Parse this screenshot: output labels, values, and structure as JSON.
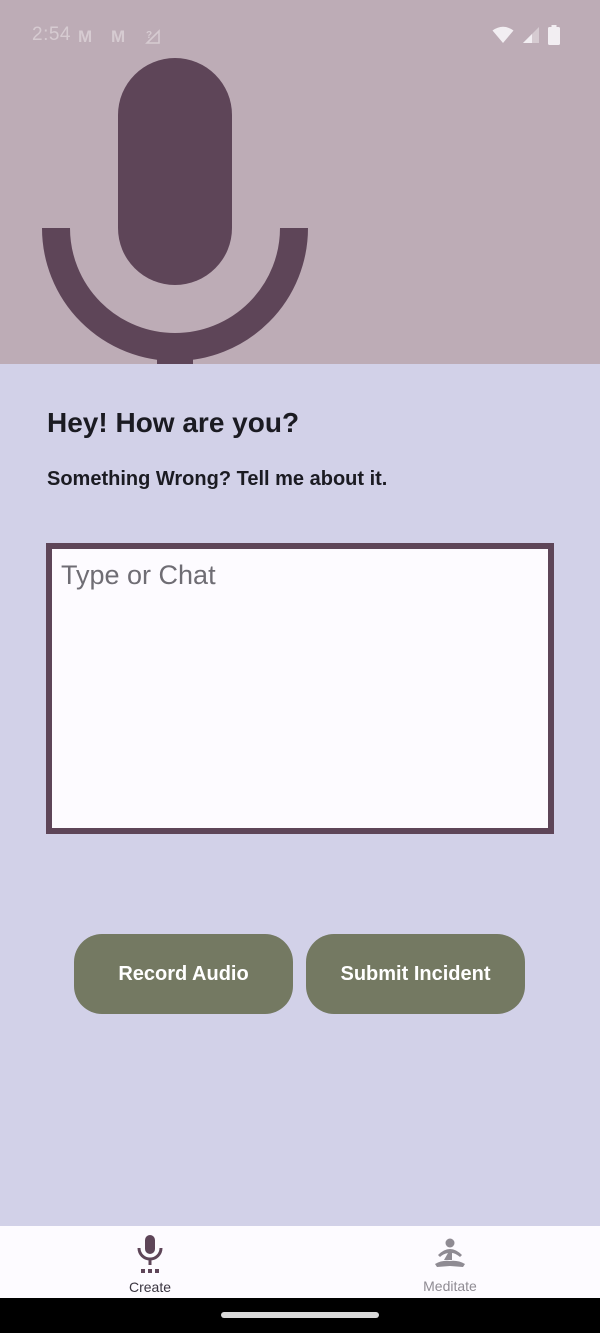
{
  "status_bar": {
    "time": "2:54",
    "icons": [
      "gmail-icon",
      "gmail-icon",
      "no-signal-icon",
      "wifi-icon",
      "signal-icon",
      "battery-icon"
    ]
  },
  "hero": {
    "icon": "microphone-icon"
  },
  "main": {
    "greeting": "Hey! How are you?",
    "subtitle": "Something Wrong? Tell me about it.",
    "chat_placeholder": "Type or Chat",
    "chat_value": ""
  },
  "buttons": {
    "record_label": "Record Audio",
    "submit_label": "Submit Incident"
  },
  "bottom_nav": {
    "items": [
      {
        "label": "Create",
        "icon": "microphone-icon",
        "selected": true
      },
      {
        "label": "Meditate",
        "icon": "meditation-icon",
        "selected": false
      }
    ]
  },
  "colors": {
    "hero_bg": "#bdacb6",
    "content_bg": "#d2d1e8",
    "accent": "#5e4558",
    "button": "#747962"
  }
}
